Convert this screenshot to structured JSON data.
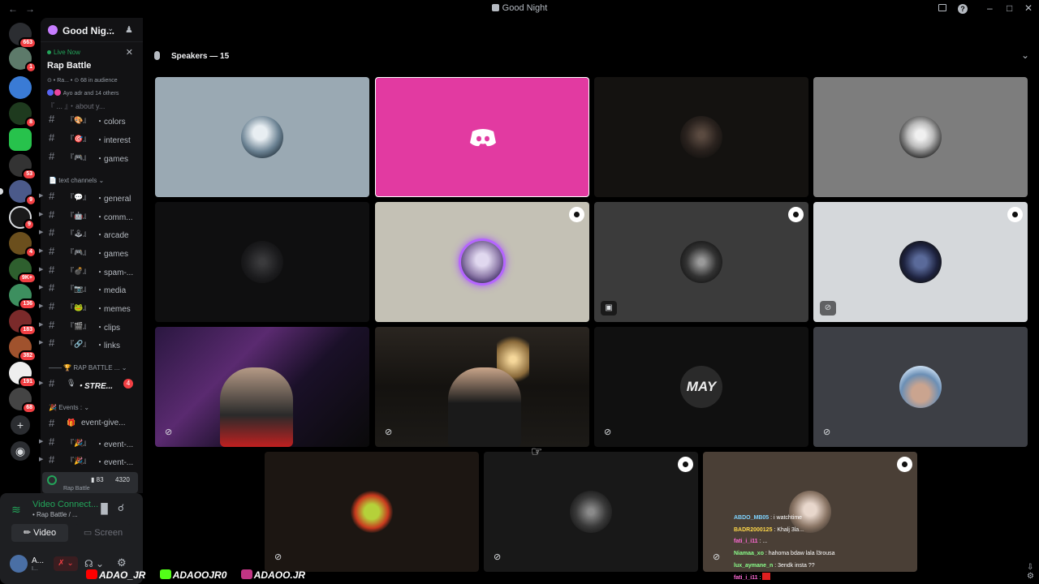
{
  "window": {
    "title": "Good Night"
  },
  "rail": {
    "badges": [
      "663",
      "1",
      "8",
      "53",
      "9",
      "9",
      "4",
      "9K+",
      "136",
      "183",
      "382",
      "191",
      "68"
    ]
  },
  "server": {
    "name": "Good Nig..."
  },
  "live": {
    "status": "Live Now",
    "stage_title": "Rap Battle",
    "meta": "⊙ • Ra... • ⊙ 68 in audience",
    "others": "Ayo adr and 14 others",
    "cut_channel": "『 ... 』・about y..."
  },
  "channels": [
    {
      "emoji": "『🎨』",
      "name": "・colors"
    },
    {
      "emoji": "『🎯』",
      "name": "・interest"
    },
    {
      "emoji": "『🎮』",
      "name": "・games"
    }
  ],
  "text_category": "text channels",
  "text_channels": [
    {
      "emoji": "『💬』",
      "name": "・general"
    },
    {
      "emoji": "『🤖』",
      "name": "・comm..."
    },
    {
      "emoji": "『🕹』",
      "name": "・arcade"
    },
    {
      "emoji": "『🎮』",
      "name": "・games"
    },
    {
      "emoji": "『💣』",
      "name": "・spam-..."
    },
    {
      "emoji": "『📷』",
      "name": "・media"
    },
    {
      "emoji": "『🐸』",
      "name": "・memes"
    },
    {
      "emoji": "『🎬』",
      "name": "・clips"
    },
    {
      "emoji": "『🔗』",
      "name": "・links"
    }
  ],
  "rap_category": "RAP BATTLE ...",
  "stream_channel": {
    "emoji": "🎙",
    "name": "・STRE...",
    "count": "4"
  },
  "events_category": "Events :",
  "event_channels": [
    {
      "emoji": "🎁",
      "name": "event-give..."
    },
    {
      "emoji": "『🎉』",
      "name": "・event-..."
    },
    {
      "emoji": "『🎉』",
      "name": "・event-..."
    }
  ],
  "active_voice": {
    "video_count": "83",
    "audience": "4320",
    "label": "Rap Battle"
  },
  "voice_panel": {
    "title": "Video Connect...",
    "subtitle": "• Rap Battle / ...",
    "video_label": "Video",
    "screen_label": "Screen"
  },
  "user": {
    "name": "A...",
    "status": "I..."
  },
  "stage": {
    "speakers_label": "Speakers — 15"
  },
  "chat": [
    {
      "user": "ABDO_MB05",
      "color": "#7fd3ff",
      "text": ": i watchtime"
    },
    {
      "user": "BADR2000125",
      "color": "#ffd84a",
      "text": ": Khalj 3la..."
    },
    {
      "user": "fati_i_i11",
      "color": "#ff6ad5",
      "text": ": ..."
    },
    {
      "user": "Niamaa_xo",
      "color": "#8bff8b",
      "text": ": hahoma bdaw lala l3rousa"
    },
    {
      "user": "lux_aymane_n",
      "color": "#8bff8b",
      "text": ": 3endk insta ??"
    },
    {
      "user": "fati_i_i11",
      "color": "#ff6ad5",
      "text": ":"
    }
  ],
  "watermark": [
    "ADAO_JR",
    "ADAOOJR0",
    "ADAOO.JR"
  ]
}
